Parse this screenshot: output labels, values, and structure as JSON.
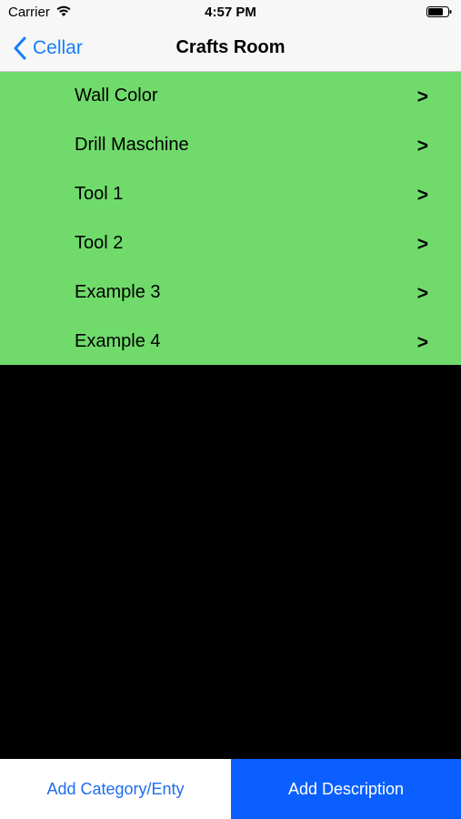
{
  "status_bar": {
    "carrier": "Carrier",
    "time": "4:57 PM"
  },
  "nav": {
    "back_label": "Cellar",
    "title": "Crafts Room"
  },
  "list": {
    "items": [
      {
        "label": "Wall Color",
        "chevron": ">"
      },
      {
        "label": "Drill Maschine",
        "chevron": ">"
      },
      {
        "label": "Tool 1",
        "chevron": ">"
      },
      {
        "label": "Tool 2",
        "chevron": ">"
      },
      {
        "label": "Example 3",
        "chevron": ">"
      },
      {
        "label": "Example 4",
        "chevron": ">"
      }
    ]
  },
  "toolbar": {
    "add_category_label": "Add Category/Enty",
    "add_description_label": "Add Description"
  },
  "colors": {
    "list_bg": "#70db6b",
    "accent": "#147efb",
    "primary_button": "#0a5ffe",
    "background": "#000000"
  }
}
